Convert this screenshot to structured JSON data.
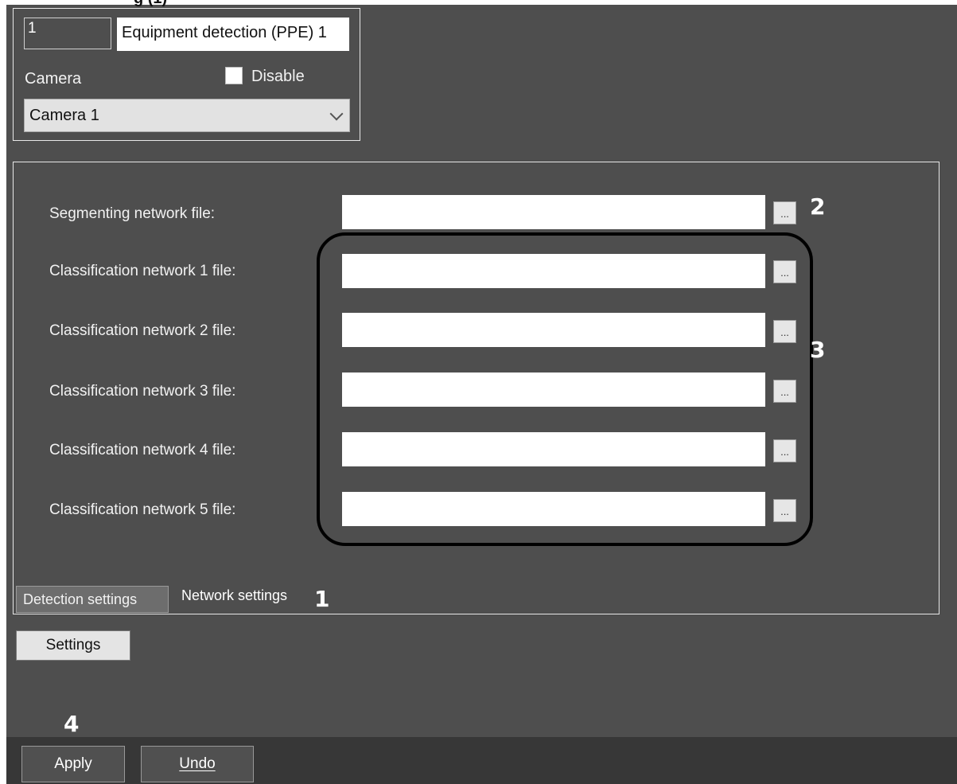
{
  "page": {
    "cutoff_heading": "g  (1)"
  },
  "header": {
    "id_value": "1",
    "name_value": "Equipment detection (PPE) 1",
    "camera_label": "Camera",
    "disable_label": "Disable",
    "disable_checked": false,
    "camera_selected": "Camera 1"
  },
  "network_settings": {
    "rows": [
      {
        "label": "Segmenting network file:",
        "value": "",
        "browse": "..."
      },
      {
        "label": "Classification network 1 file:",
        "value": "",
        "browse": "..."
      },
      {
        "label": "Classification network 2 file:",
        "value": "",
        "browse": "..."
      },
      {
        "label": "Classification network 3 file:",
        "value": "",
        "browse": "..."
      },
      {
        "label": "Classification network 4 file:",
        "value": "",
        "browse": "..."
      },
      {
        "label": "Classification network 5 file:",
        "value": "",
        "browse": "..."
      }
    ]
  },
  "tabs": [
    {
      "label": "Detection settings",
      "active": true
    },
    {
      "label": "Network settings",
      "active": false
    }
  ],
  "buttons": {
    "settings": "Settings",
    "apply": "Apply",
    "undo": "Undo"
  },
  "callouts": {
    "one": "1",
    "two": "2",
    "three": "3",
    "four": "4"
  },
  "colors": {
    "panel_bg": "#4e4e4e",
    "footer_bg": "#373737",
    "highlight_border": "#000000"
  }
}
